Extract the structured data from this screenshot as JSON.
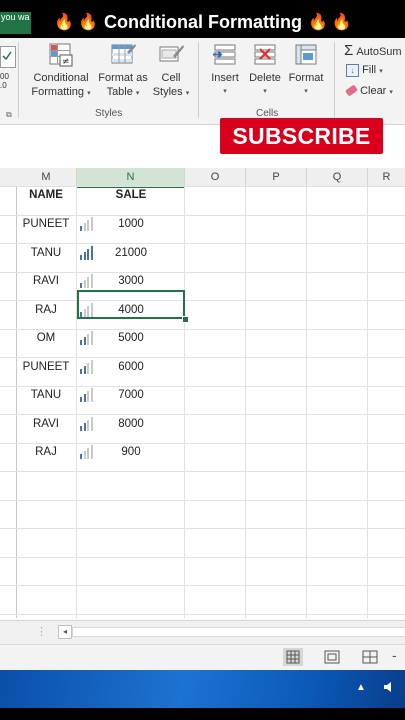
{
  "overlay": {
    "title": "Conditional Formatting",
    "flame": "🔥",
    "subscribe": "SUBSCRIBE",
    "left_snippet": "you wa"
  },
  "ribbon": {
    "conditional_formatting": [
      "Conditional",
      "Formatting"
    ],
    "format_as_table": [
      "Format as",
      "Table"
    ],
    "cell_styles": [
      "Cell",
      "Styles"
    ],
    "styles_group_label": "Styles",
    "insert": "Insert",
    "delete": "Delete",
    "format": "Format",
    "cells_group_label": "Cells",
    "autosum": "AutoSum",
    "fill": "Fill",
    "clear": "Clear",
    "left_number_label": "00\n.0",
    "icons": {
      "conditional_formatting": "conditional-formatting-icon",
      "format_as_table": "format-table-icon",
      "cell_styles": "cell-styles-icon",
      "insert": "insert-cells-icon",
      "delete": "delete-cells-icon",
      "format": "format-cells-icon",
      "autosum": "sigma-icon",
      "fill": "fill-down-icon",
      "clear": "eraser-icon"
    }
  },
  "columns": [
    "M",
    "N",
    "O",
    "P",
    "Q",
    "R"
  ],
  "selected_column": "N",
  "table": {
    "header_name": "NAME",
    "header_sale": "SALE",
    "rows": [
      {
        "name": "PUNEET",
        "sale": "1000"
      },
      {
        "name": "TANU",
        "sale": "21000"
      },
      {
        "name": "RAVI",
        "sale": "3000"
      },
      {
        "name": "RAJ",
        "sale": "4000"
      },
      {
        "name": "OM",
        "sale": "5000"
      },
      {
        "name": "PUNEET",
        "sale": "6000"
      },
      {
        "name": "TANU",
        "sale": "7000"
      },
      {
        "name": "RAVI",
        "sale": "8000"
      },
      {
        "name": "RAJ",
        "sale": "900"
      }
    ],
    "active_row_index": 3
  },
  "colors": {
    "excel_green": "#217346",
    "bar_filled": "#4a72a8",
    "bar_empty": "#c9c9c9",
    "subscribe_red": "#d9001b"
  }
}
